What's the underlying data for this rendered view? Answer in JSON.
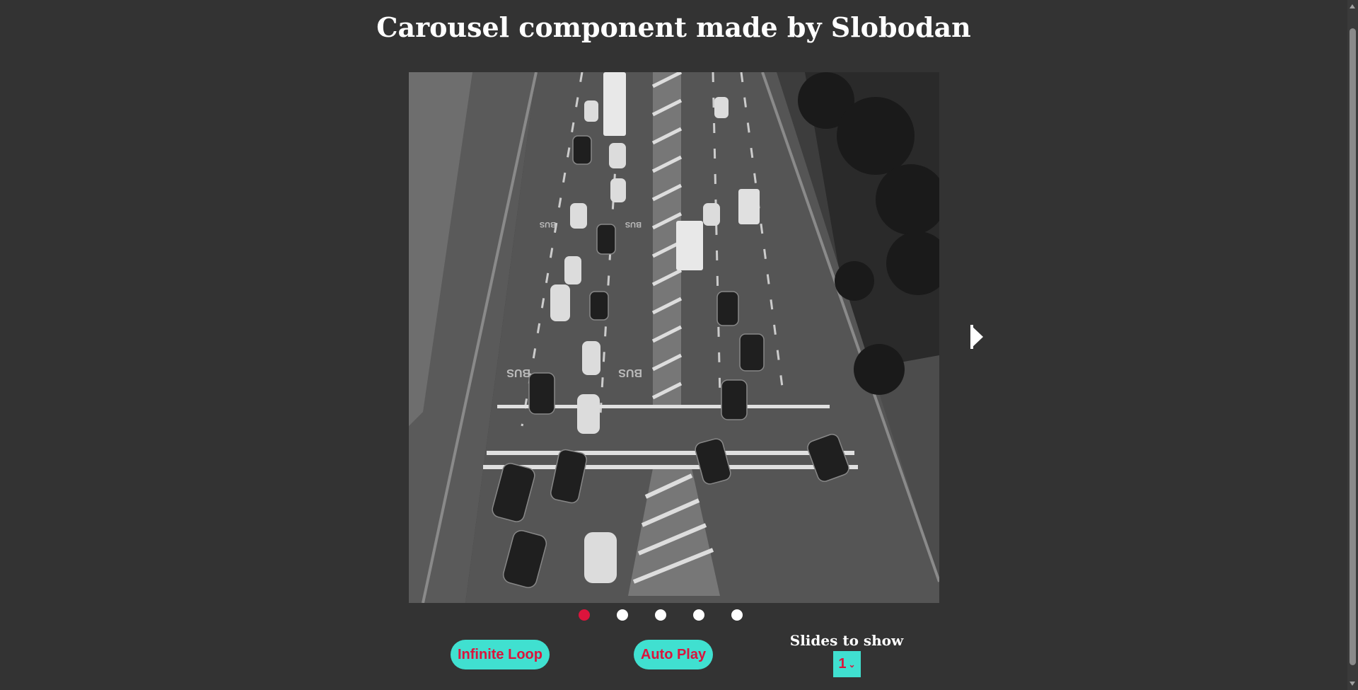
{
  "page": {
    "title": "Carousel component made by Slobodan"
  },
  "carousel": {
    "slide_count": 5,
    "active_index": 0,
    "current_slide": {
      "image_description": "Black and white aerial photo of a multi-lane city avenue with cars, a truck and crosswalks",
      "road_markings": [
        "BUS",
        "BUS",
        "BUS",
        "BUS"
      ]
    },
    "next_arrow_icon": "chevron-right-icon",
    "dots": [
      {
        "active": true
      },
      {
        "active": false
      },
      {
        "active": false
      },
      {
        "active": false
      },
      {
        "active": false
      }
    ]
  },
  "controls": {
    "infinite_loop_label": "Infinite Loop",
    "auto_play_label": "Auto Play",
    "slides_to_show_label": "Slides to show",
    "slides_to_show_value": "1"
  },
  "colors": {
    "background": "#333333",
    "accent_turquoise": "#40e0d0",
    "accent_crimson": "#dc143c",
    "text": "#ffffff"
  }
}
